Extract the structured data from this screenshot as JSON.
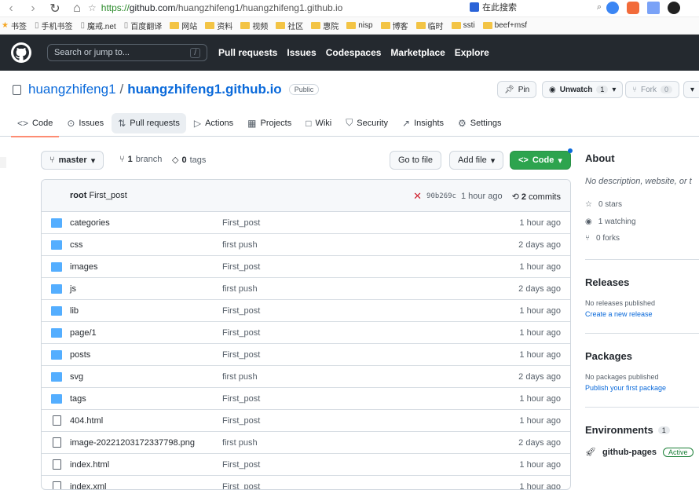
{
  "browser": {
    "url_scheme": "https://",
    "url_host": "github.com",
    "url_path": "/huangzhifeng1/huangzhifeng1.github.io",
    "search_placeholder": "在此搜索"
  },
  "bookmarks": [
    {
      "label": "书签",
      "type": "star"
    },
    {
      "label": "手机书签",
      "type": "page"
    },
    {
      "label": "魔戒.net",
      "type": "page"
    },
    {
      "label": "百度翻译",
      "type": "page"
    },
    {
      "label": "网站",
      "type": "folder"
    },
    {
      "label": "资料",
      "type": "folder"
    },
    {
      "label": "视频",
      "type": "folder"
    },
    {
      "label": "社区",
      "type": "folder"
    },
    {
      "label": "惠院",
      "type": "folder"
    },
    {
      "label": "nisp",
      "type": "folder"
    },
    {
      "label": "博客",
      "type": "folder"
    },
    {
      "label": "临时",
      "type": "folder"
    },
    {
      "label": "ssti",
      "type": "folder"
    },
    {
      "label": "beef+msf",
      "type": "folder"
    }
  ],
  "header": {
    "search_placeholder": "Search or jump to...",
    "search_key": "/",
    "nav": [
      "Pull requests",
      "Issues",
      "Codespaces",
      "Marketplace",
      "Explore"
    ]
  },
  "repo": {
    "owner": "huangzhifeng1",
    "separator": "/",
    "name": "huangzhifeng1.github.io",
    "visibility": "Public",
    "pin_label": "Pin",
    "watch_label": "Unwatch",
    "watch_count": "1",
    "fork_label": "Fork",
    "fork_count": "0"
  },
  "tabs": [
    {
      "label": "Code",
      "icon": "code-icon",
      "glyph": "<>"
    },
    {
      "label": "Issues",
      "icon": "issue-icon",
      "glyph": "⊙"
    },
    {
      "label": "Pull requests",
      "icon": "pull-request-icon",
      "glyph": "⇅"
    },
    {
      "label": "Actions",
      "icon": "play-icon",
      "glyph": "▷"
    },
    {
      "label": "Projects",
      "icon": "table-icon",
      "glyph": "▦"
    },
    {
      "label": "Wiki",
      "icon": "book-icon",
      "glyph": "□"
    },
    {
      "label": "Security",
      "icon": "shield-icon",
      "glyph": "⛉"
    },
    {
      "label": "Insights",
      "icon": "graph-icon",
      "glyph": "↗"
    },
    {
      "label": "Settings",
      "icon": "gear-icon",
      "glyph": "⚙"
    }
  ],
  "branch": {
    "current": "master",
    "branch_count": "1",
    "branch_word": "branch",
    "tag_count": "0",
    "tag_word": "tags",
    "go_to_file": "Go to file",
    "add_file": "Add file",
    "code": "Code"
  },
  "commit": {
    "user": "root",
    "message": "First_post",
    "sha": "90b269c",
    "age": "1 hour ago",
    "commit_count": "2",
    "commit_word": "commits"
  },
  "files": [
    {
      "name": "categories",
      "type": "dir",
      "message": "First_post",
      "age": "1 hour ago"
    },
    {
      "name": "css",
      "type": "dir",
      "message": "first push",
      "age": "2 days ago"
    },
    {
      "name": "images",
      "type": "dir",
      "message": "First_post",
      "age": "1 hour ago"
    },
    {
      "name": "js",
      "type": "dir",
      "message": "first push",
      "age": "2 days ago"
    },
    {
      "name": "lib",
      "type": "dir",
      "message": "First_post",
      "age": "1 hour ago"
    },
    {
      "name": "page/1",
      "type": "dir",
      "message": "First_post",
      "age": "1 hour ago"
    },
    {
      "name": "posts",
      "type": "dir",
      "message": "First_post",
      "age": "1 hour ago"
    },
    {
      "name": "svg",
      "type": "dir",
      "message": "first push",
      "age": "2 days ago"
    },
    {
      "name": "tags",
      "type": "dir",
      "message": "First_post",
      "age": "1 hour ago"
    },
    {
      "name": "404.html",
      "type": "file",
      "message": "First_post",
      "age": "1 hour ago"
    },
    {
      "name": "image-20221203172337798.png",
      "type": "file",
      "message": "first push",
      "age": "2 days ago"
    },
    {
      "name": "index.html",
      "type": "file",
      "message": "First_post",
      "age": "1 hour ago"
    },
    {
      "name": "index.xml",
      "type": "file",
      "message": "First_post",
      "age": "1 hour ago"
    }
  ],
  "sidebar": {
    "about_title": "About",
    "description": "No description, website, or t",
    "stars": "0 stars",
    "watching": "1 watching",
    "forks": "0 forks",
    "releases_title": "Releases",
    "releases_none": "No releases published",
    "releases_link": "Create a new release",
    "packages_title": "Packages",
    "packages_none": "No packages published",
    "packages_link": "Publish your first package",
    "environments_title": "Environments",
    "environments_count": "1",
    "env_name": "github-pages",
    "env_status": "Active"
  }
}
